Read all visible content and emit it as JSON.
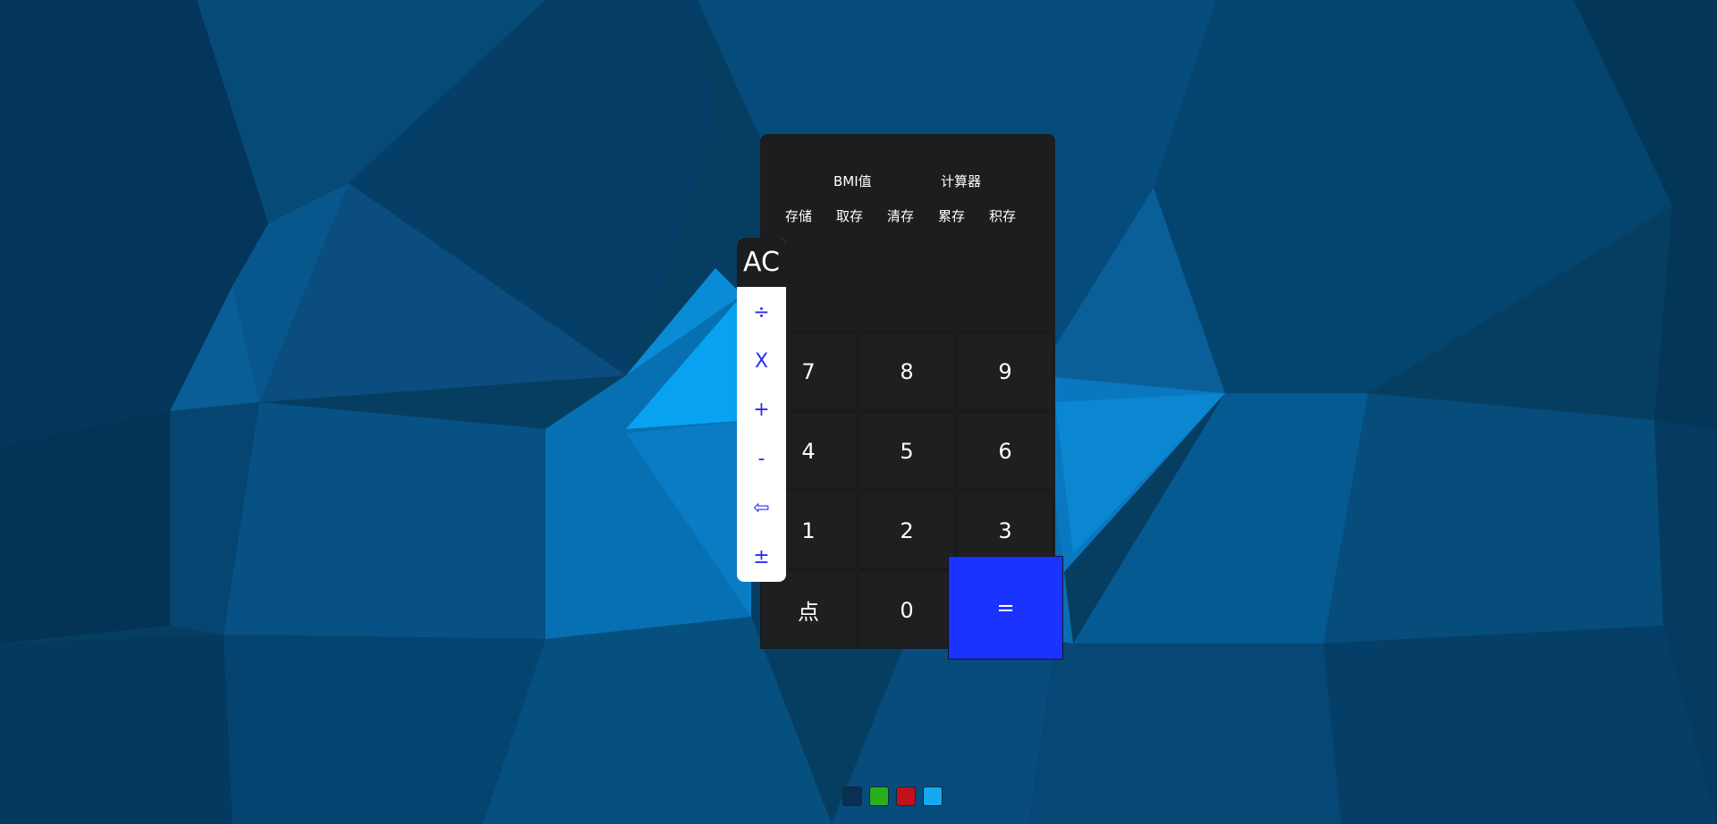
{
  "modes": [
    {
      "label": "BMI值"
    },
    {
      "label": "计算器"
    }
  ],
  "memory": [
    {
      "label": "存储"
    },
    {
      "label": "取存"
    },
    {
      "label": "清存"
    },
    {
      "label": "累存"
    },
    {
      "label": "积存"
    }
  ],
  "display": {
    "value": ""
  },
  "keys": {
    "k7": "7",
    "k8": "8",
    "k9": "9",
    "k4": "4",
    "k5": "5",
    "k6": "6",
    "k1": "1",
    "k2": "2",
    "k3": "3",
    "point": "点",
    "k0": "0",
    "equals": "="
  },
  "operators": {
    "clear": "AC",
    "divide": "÷",
    "multiply": "X",
    "plus": "+",
    "minus": "-",
    "backspace": "⇦",
    "negate": "±"
  },
  "theme_swatches": [
    {
      "name": "dark-navy",
      "color": "#0a2f52"
    },
    {
      "name": "green",
      "color": "#27b01c"
    },
    {
      "name": "red",
      "color": "#c0101a"
    },
    {
      "name": "light-blue",
      "color": "#16a8f0"
    }
  ],
  "colors": {
    "calculator_body": "#1c1d1f",
    "accent_blue": "#1a33ff",
    "operator_text": "#2a2ef0"
  }
}
